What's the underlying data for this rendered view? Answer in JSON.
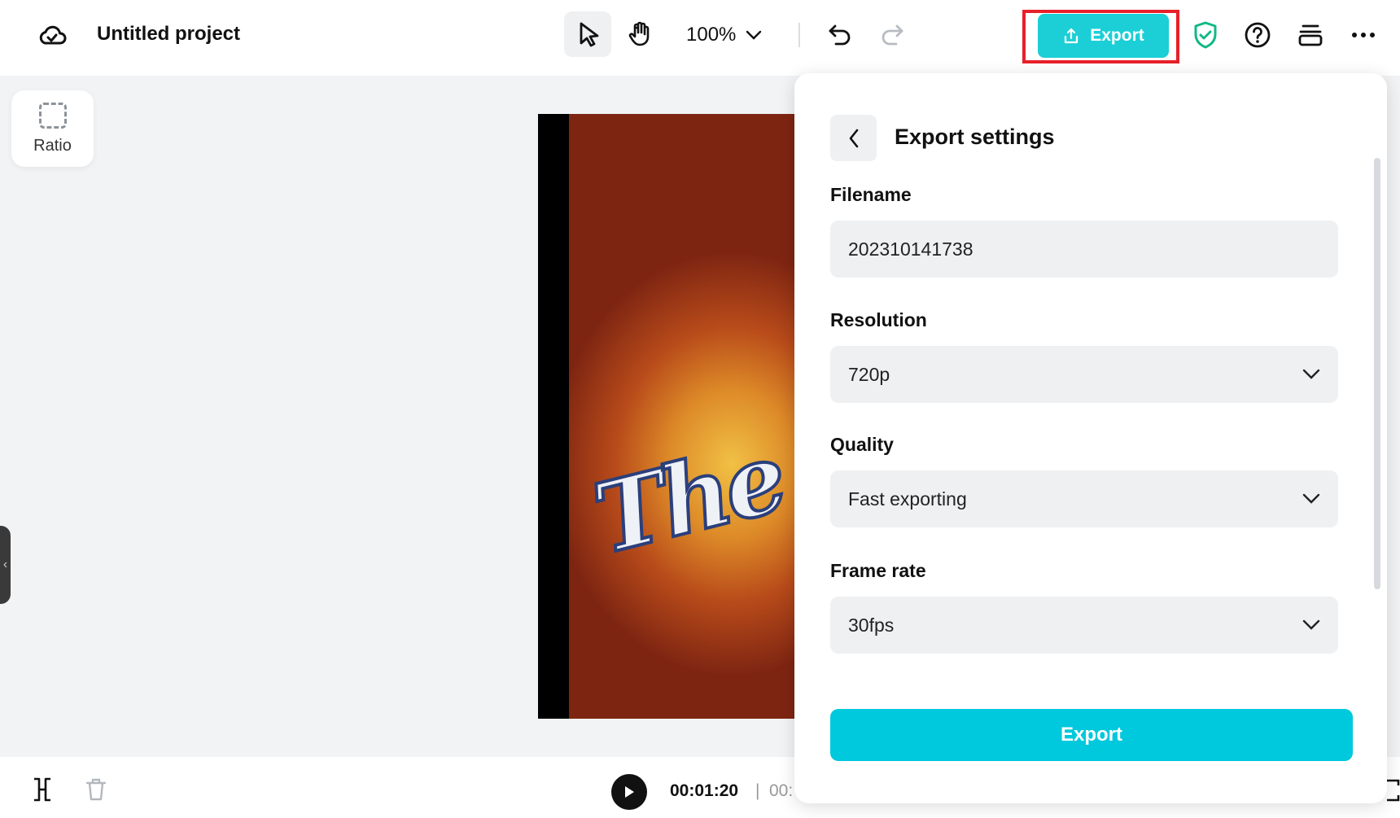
{
  "header": {
    "project_title": "Untitled project",
    "zoom_value": "100%",
    "export_label": "Export"
  },
  "canvas": {
    "ratio_label": "Ratio"
  },
  "export_panel": {
    "title": "Export settings",
    "filename": {
      "label": "Filename",
      "value": "202310141738"
    },
    "resolution": {
      "label": "Resolution",
      "value": "720p"
    },
    "quality": {
      "label": "Quality",
      "value": "Fast exporting"
    },
    "frame_rate": {
      "label": "Frame rate",
      "value": "30fps"
    },
    "export_button": "Export"
  },
  "playback": {
    "current_time": "00:01:20",
    "separator": "|",
    "total_time": "00:"
  },
  "icons": {
    "cloud": "cloud-icon",
    "select": "pointer-icon",
    "hand": "hand-icon",
    "undo": "undo-icon",
    "redo": "redo-icon",
    "shield": "shield-check-icon",
    "help": "help-circle-icon",
    "layers": "layers-icon",
    "more": "more-horizontal-icon",
    "back": "chevron-left-icon",
    "dropdown": "chevron-down-icon",
    "play": "play-icon",
    "split": "split-icon",
    "trash": "trash-icon"
  },
  "colors": {
    "accent": "#00c8dd",
    "export_top": "#1ccfd6",
    "highlight_border": "#e8202a",
    "shield_green": "#12b886"
  }
}
